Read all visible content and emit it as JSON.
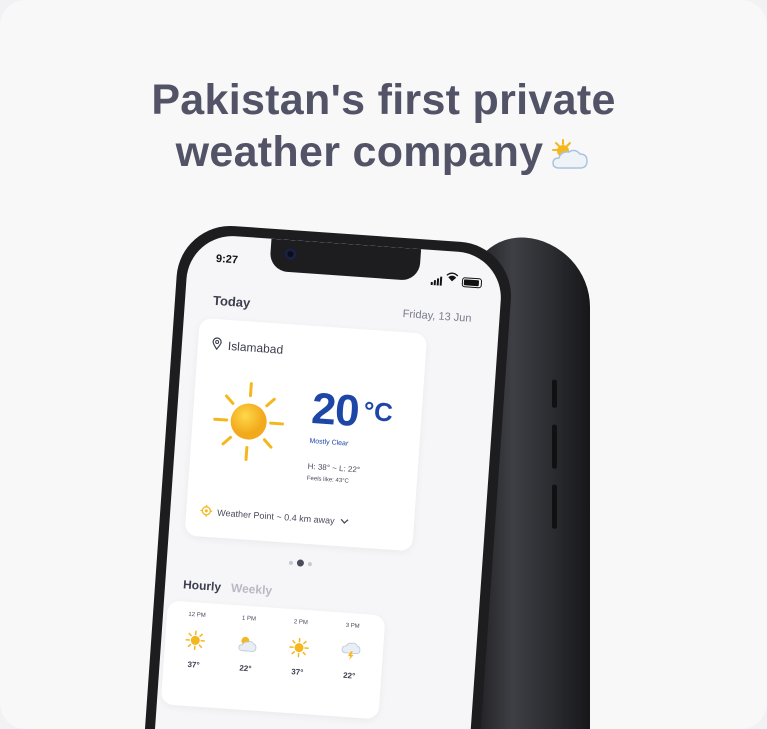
{
  "headline": {
    "line1": "Pakistan's first private",
    "line2": "weather company",
    "emoji_icon": "sun-behind-cloud-icon"
  },
  "status_bar": {
    "time": "9:27"
  },
  "header": {
    "today_label": "Today",
    "date": "Friday, 13 Jun"
  },
  "weather_card": {
    "location": "Islamabad",
    "temperature": "20",
    "unit": "°C",
    "condition": "Mostly Clear",
    "high_low": "H: 38°  ~  L: 22°",
    "feels_like": "Feels like: 43°C",
    "weather_point": "Weather Point ~ 0.4 km away"
  },
  "pager": {
    "count": 3,
    "active_index": 1
  },
  "tabs": {
    "hourly": "Hourly",
    "weekly": "Weekly"
  },
  "hourly": [
    {
      "time": "12 PM",
      "icon": "sun-icon",
      "temp": "37°"
    },
    {
      "time": "1 PM",
      "icon": "cloud-sun-icon",
      "temp": "22°"
    },
    {
      "time": "2 PM",
      "icon": "sun-icon",
      "temp": "37°"
    },
    {
      "time": "3 PM",
      "icon": "storm-icon",
      "temp": "22°"
    }
  ],
  "colors": {
    "headline": "#525366",
    "accent_blue": "#1e46a6",
    "sun": "#f5b71e",
    "background": "#f8f8f9"
  }
}
